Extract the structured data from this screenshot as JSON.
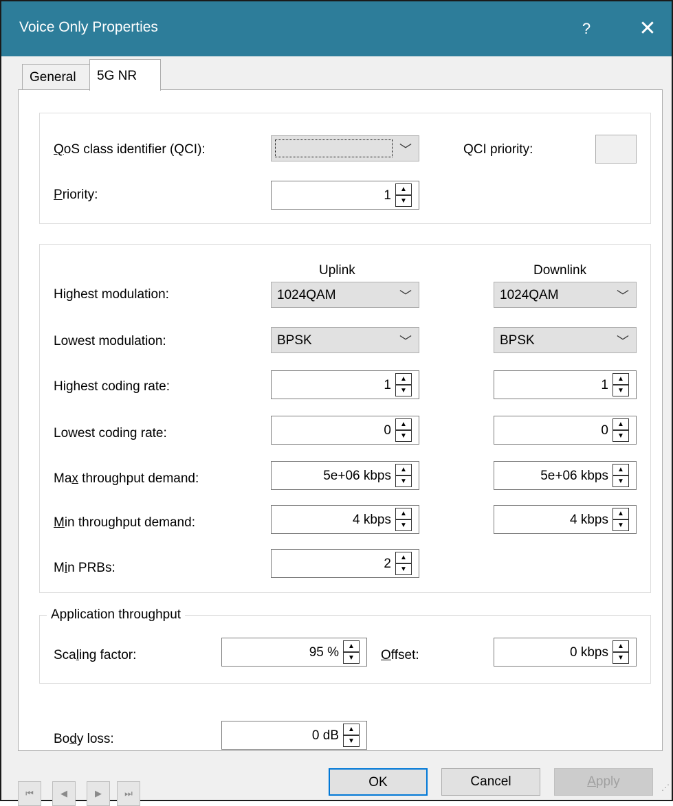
{
  "window": {
    "title": "Voice Only Properties",
    "help_label": "?",
    "close_label": "✕"
  },
  "tabs": [
    {
      "label": "General",
      "active": false
    },
    {
      "label": "5G NR",
      "active": true
    }
  ],
  "qos": {
    "qci_label_first": "Q",
    "qci_label_rest": "oS class identifier (QCI):",
    "qci_value": "",
    "qci_priority_label": "QCI priority:",
    "qci_priority_value": "",
    "priority_label_first": "P",
    "priority_label_rest": "riority:",
    "priority_value": "1"
  },
  "link": {
    "uplink_header": "Uplink",
    "downlink_header": "Downlink",
    "rows": {
      "highest_modulation": {
        "label": "Highest modulation:",
        "uplink": "1024QAM",
        "downlink": "1024QAM"
      },
      "lowest_modulation": {
        "label": "Lowest modulation:",
        "uplink": "BPSK",
        "downlink": "BPSK"
      },
      "highest_coding_rate": {
        "label": "Highest coding rate:",
        "uplink": "1",
        "downlink": "1"
      },
      "lowest_coding_rate": {
        "label": "Lowest coding rate:",
        "uplink": "0",
        "downlink": "0"
      },
      "max_throughput": {
        "label_a": "Ma",
        "label_u": "x",
        "label_b": " throughput demand:",
        "uplink": "5e+06 kbps",
        "downlink": "5e+06 kbps"
      },
      "min_throughput": {
        "label_u": "M",
        "label_b": "in throughput demand:",
        "uplink": "4 kbps",
        "downlink": "4 kbps"
      },
      "min_prbs": {
        "label_a": "M",
        "label_u": "i",
        "label_b": "n PRBs:",
        "uplink": "2"
      }
    }
  },
  "app_throughput": {
    "group_title": "Application throughput",
    "scaling_label_a": "Sca",
    "scaling_label_u": "l",
    "scaling_label_b": "ing factor:",
    "scaling_value": "95 %",
    "offset_label_u": "O",
    "offset_label_b": "ffset:",
    "offset_value": "0 kbps"
  },
  "body_loss": {
    "label_a": "Bo",
    "label_u": "d",
    "label_b": "y loss:",
    "value": "0 dB"
  },
  "footer": {
    "nav_first": "⏮",
    "nav_prev": "◀",
    "nav_next": "▶",
    "nav_last": "⏭",
    "ok_label": "OK",
    "cancel_label": "Cancel",
    "apply_label_u": "A",
    "apply_label_b": "pply"
  },
  "spin_up": "▲",
  "spin_down": "▼",
  "dropdown_arrow": "﹀"
}
